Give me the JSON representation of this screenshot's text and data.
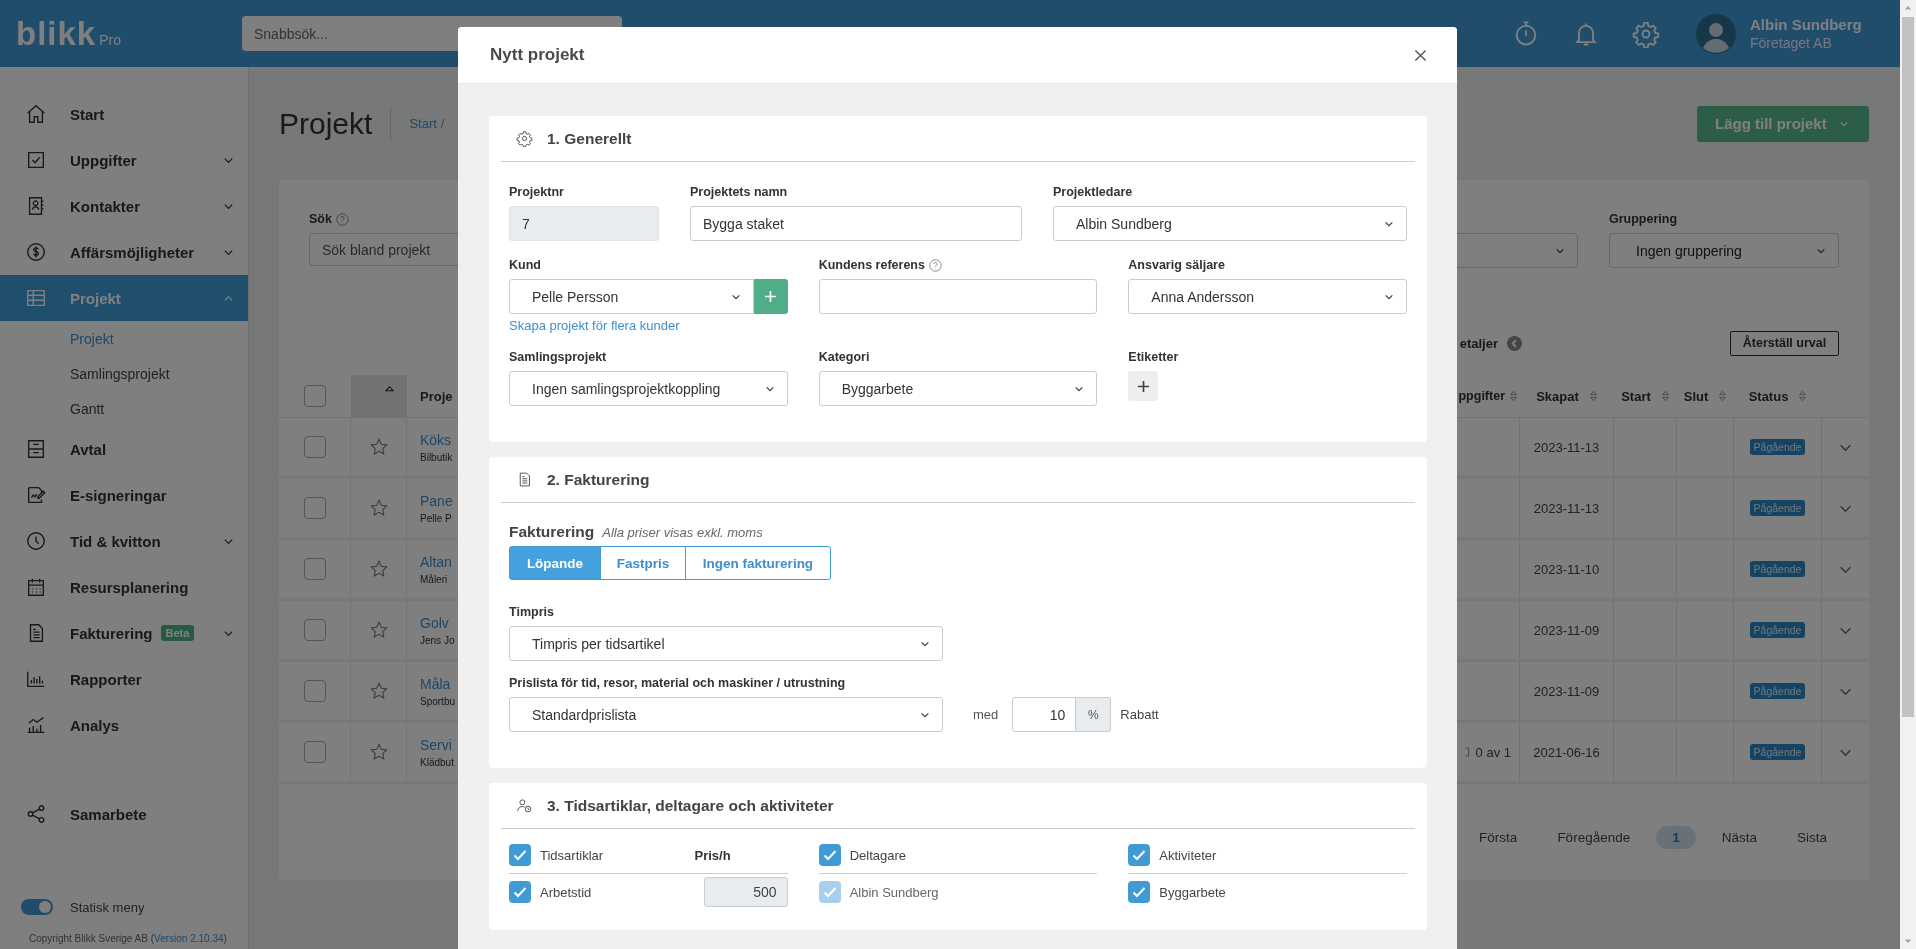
{
  "topbar": {
    "logo": "blikk",
    "logo_suffix": "Pro",
    "search_placeholder": "Snabbsök...",
    "user": {
      "name": "Albin Sundberg",
      "company": "Företaget AB"
    }
  },
  "sidebar": {
    "items": [
      {
        "label": "Start",
        "kind": "link",
        "selected": false
      },
      {
        "label": "Uppgifter",
        "kind": "group",
        "expanded": false,
        "selected": false
      },
      {
        "label": "Kontakter",
        "kind": "group",
        "expanded": false,
        "selected": false
      },
      {
        "label": "Affärsmöjligheter",
        "kind": "group",
        "expanded": false,
        "selected": false
      },
      {
        "label": "Projekt",
        "kind": "group",
        "expanded": true,
        "selected": true,
        "children": [
          {
            "label": "Projekt",
            "selected": true
          },
          {
            "label": "Samlingsprojekt",
            "selected": false
          },
          {
            "label": "Gantt",
            "selected": false
          }
        ]
      },
      {
        "label": "Avtal",
        "kind": "link",
        "selected": false
      },
      {
        "label": "E-signeringar",
        "kind": "link",
        "selected": false
      },
      {
        "label": "Tid & kvitton",
        "kind": "group",
        "expanded": false,
        "selected": false
      },
      {
        "label": "Resursplanering",
        "kind": "link",
        "selected": false
      },
      {
        "label": "Fakturering",
        "kind": "group",
        "expanded": false,
        "selected": false,
        "badge": "Beta"
      },
      {
        "label": "Rapporter",
        "kind": "link",
        "selected": false
      },
      {
        "label": "Analys",
        "kind": "link",
        "selected": false
      }
    ],
    "secondary_items": [
      {
        "label": "Samarbete",
        "selected": false
      }
    ],
    "toggle": {
      "label": "Statisk meny",
      "on": true
    },
    "copyright": {
      "before": "Copyright Blikk Sverige AB (",
      "link": "Version 2.10.34",
      "after": ")"
    }
  },
  "page": {
    "title": "Projekt",
    "breadcrumb_link": "Start",
    "breadcrumb_separator": "/",
    "add_button": "Lägg till projekt"
  },
  "filters": {
    "search": {
      "label": "Sök",
      "placeholder": "Sök bland projekt"
    },
    "grouping": {
      "label": "Gruppering",
      "value": "Ingen gruppering"
    },
    "details_toggle": "etaljer",
    "reset_button": "Återställ urval"
  },
  "table": {
    "columns": [
      {
        "kind": "select",
        "checked": false
      },
      {
        "kind": "favorite",
        "sorted": true
      },
      {
        "kind": "text",
        "label": "Proje"
      },
      {
        "kind": "text",
        "label": "ppgifter",
        "sortable": true
      },
      {
        "kind": "text",
        "label": "Skapat",
        "sortable": true
      },
      {
        "kind": "text",
        "label": "Start",
        "sortable": true
      },
      {
        "kind": "text",
        "label": "Slut",
        "sortable": true
      },
      {
        "kind": "text",
        "label": "Status",
        "sortable": true
      }
    ],
    "rows": [
      {
        "checked": false,
        "starred": false,
        "name": "Köks",
        "customer": "Bilbutik",
        "created": "2023-11-13",
        "status": "Pågående"
      },
      {
        "checked": false,
        "starred": false,
        "name": "Pane",
        "customer": "Pelle P",
        "created": "2023-11-13",
        "status": "Pågående"
      },
      {
        "checked": false,
        "starred": false,
        "name": "Altan",
        "customer": "Måleri",
        "created": "2023-11-10",
        "status": "Pågående"
      },
      {
        "checked": false,
        "starred": false,
        "name": "Golv",
        "customer": "Jens Jo",
        "created": "2023-11-09",
        "status": "Pågående"
      },
      {
        "checked": false,
        "starred": false,
        "name": "Måla",
        "customer": "Sportbu",
        "created": "2023-11-09",
        "status": "Pågående"
      },
      {
        "checked": false,
        "starred": false,
        "name": "Servi",
        "customer": "Klädbut",
        "tasks": "0 av 1",
        "created": "2021-06-16",
        "status": "Pågående"
      }
    ]
  },
  "pagination": [
    {
      "label": "Första",
      "selected": false
    },
    {
      "label": "Föregående",
      "selected": false
    },
    {
      "label": "1",
      "selected": true
    },
    {
      "label": "Nästa",
      "selected": false
    },
    {
      "label": "Sista",
      "selected": false
    }
  ],
  "modal": {
    "title": "Nytt projekt",
    "general": {
      "title": "1. Generellt",
      "rows": [
        [
          {
            "kind": "text",
            "label": "Projektnr",
            "value": "7",
            "disabled": true
          },
          {
            "kind": "text",
            "label": "Projektets namn",
            "value": "Bygga staket",
            "disabled": false
          },
          {
            "kind": "select",
            "label": "Projektledare",
            "value": "Albin Sundberg"
          }
        ],
        [
          {
            "kind": "select-add",
            "label": "Kund",
            "value": "Pelle Persson",
            "link": "Skapa projekt för flera kunder"
          },
          {
            "kind": "text",
            "label": "Kundens referens",
            "help": true,
            "disabled": false
          },
          {
            "kind": "select",
            "label": "Ansvarig säljare",
            "value": "Anna Andersson"
          }
        ],
        [
          {
            "kind": "select",
            "label": "Samlingsprojekt",
            "value": "Ingen samlingsprojektkoppling"
          },
          {
            "kind": "select",
            "label": "Kategori",
            "value": "Byggarbete"
          },
          {
            "kind": "tags",
            "label": "Etiketter"
          }
        ]
      ]
    },
    "billing": {
      "title": "2. Fakturering",
      "label": "Fakturering",
      "note": "Alla priser visas exkl. moms",
      "tabs": [
        {
          "label": "Löpande",
          "selected": true
        },
        {
          "label": "Fastpris",
          "selected": false
        },
        {
          "label": "Ingen fakturering",
          "selected": false
        }
      ],
      "hourly": {
        "label": "Timpris",
        "value": "Timpris per tidsartikel"
      },
      "pricelist": {
        "label": "Prislista för tid, resor, material och maskiner / utrustning",
        "value": "Standardprislista"
      },
      "discount": {
        "prefix": "med",
        "value": "10",
        "unit": "%",
        "suffix": "Rabatt"
      }
    },
    "time": {
      "title": "3. Tidsartiklar, deltagare och aktiviteter",
      "columns": [
        {
          "label": "Tidsartiklar",
          "checked": true,
          "price_header": "Pris/h",
          "items": [
            {
              "label": "Arbetstid",
              "checked": true,
              "disabled": false,
              "price": "500"
            }
          ]
        },
        {
          "label": "Deltagare",
          "checked": true,
          "items": [
            {
              "label": "Albin Sundberg",
              "checked": true,
              "disabled": true
            }
          ]
        },
        {
          "label": "Aktiviteter",
          "checked": true,
          "items": [
            {
              "label": "Byggarbete",
              "checked": true,
              "disabled": false
            }
          ]
        }
      ]
    }
  }
}
